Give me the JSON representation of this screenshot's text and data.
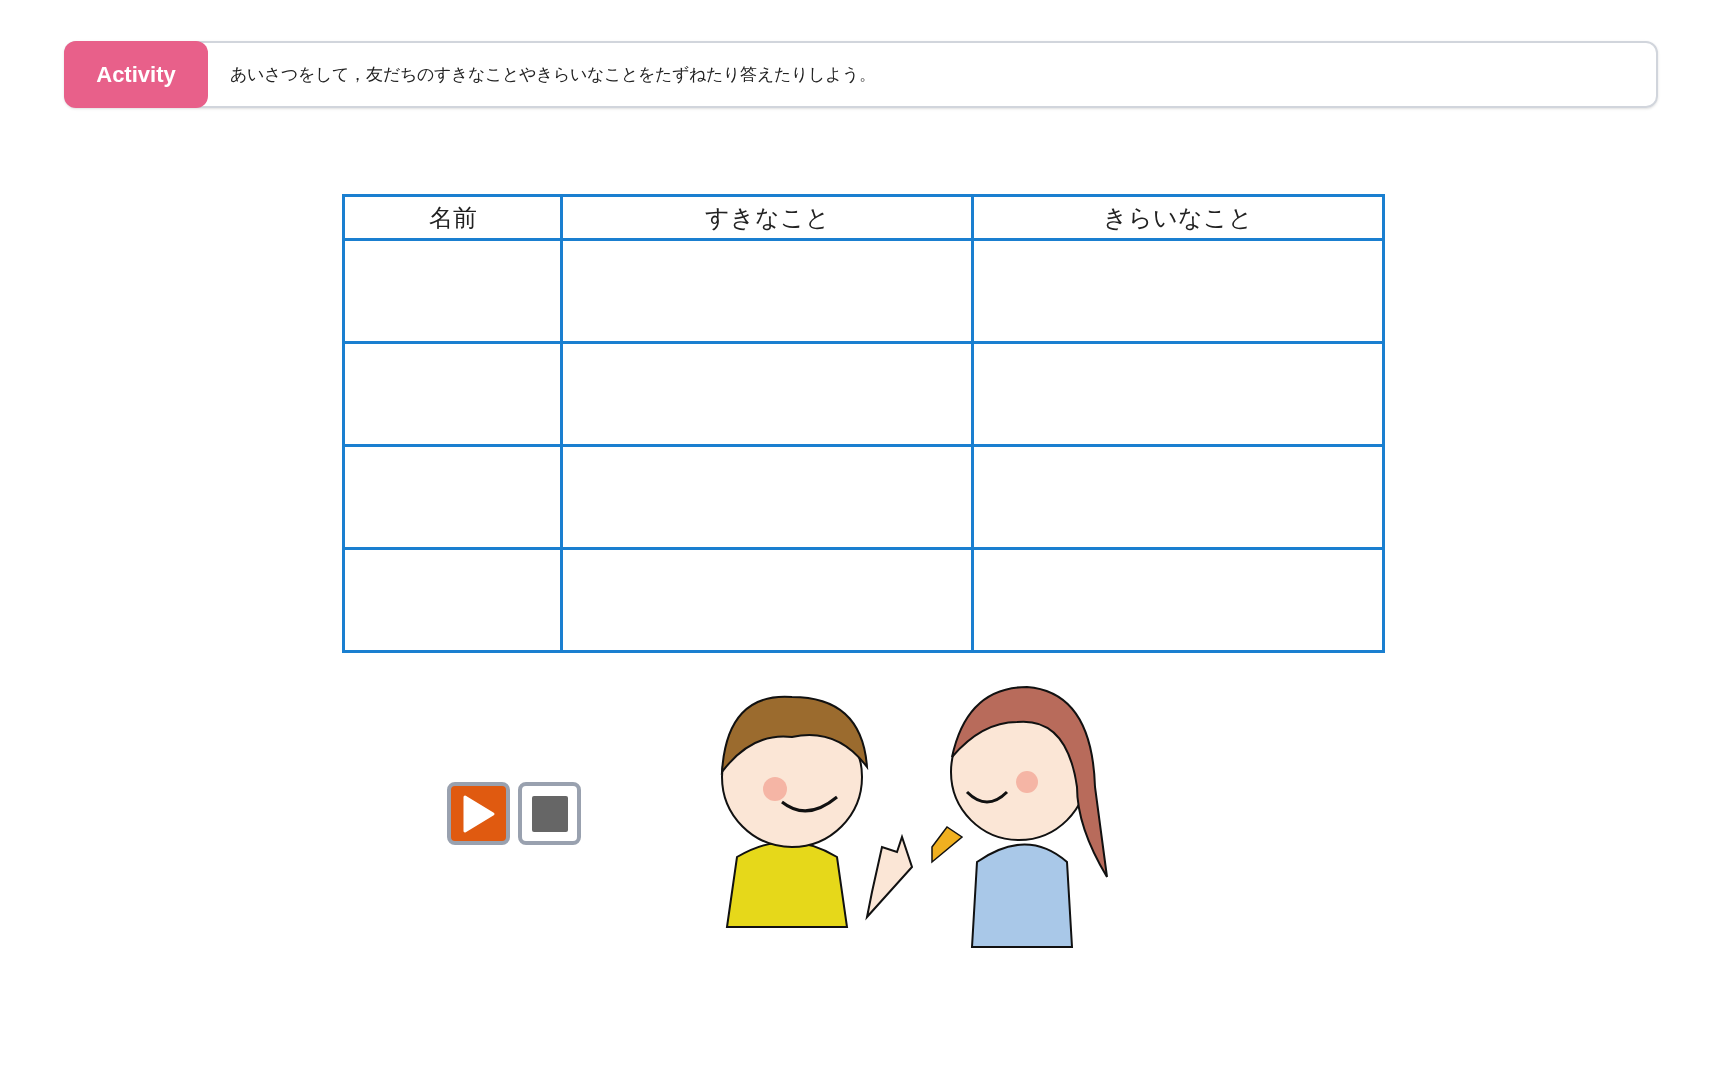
{
  "activity": {
    "badge": "Activity",
    "instruction": "あいさつをして，友だちのすきなことやきらいなことをたずねたり答えたりしよう。"
  },
  "table": {
    "columns": [
      "名前",
      "すきなこと",
      "きらいなこと"
    ],
    "rows": [
      {
        "kind": "blank"
      },
      {
        "kind": "blank"
      },
      {
        "kind": "blank"
      },
      {
        "kind": "blank"
      }
    ]
  },
  "audio_controls": [
    {
      "kind": "play"
    },
    {
      "kind": "stop"
    }
  ]
}
